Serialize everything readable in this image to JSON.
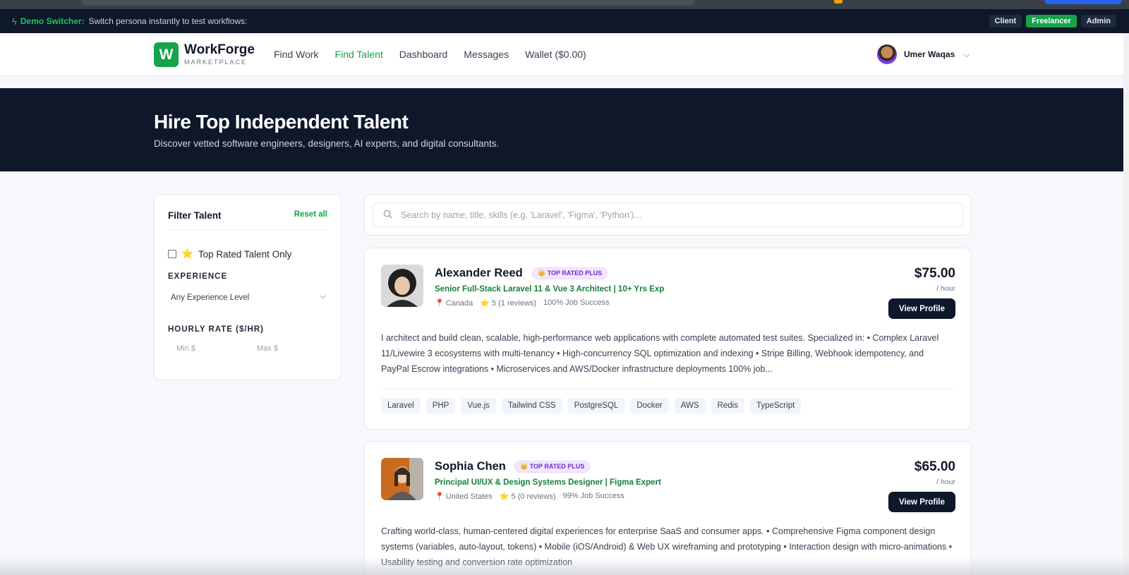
{
  "demo_bar": {
    "label": "Demo Switcher:",
    "text": "Switch persona instantly to test workflows:",
    "personas": [
      "Client",
      "Freelancer",
      "Admin"
    ]
  },
  "nav": {
    "brand": "WorkForge",
    "brand_sub": "MARKETPLACE",
    "logo_letter": "W",
    "links": [
      "Find Work",
      "Find Talent",
      "Dashboard",
      "Messages",
      "Wallet ($0.00)"
    ],
    "active_link": "Find Talent",
    "user_name": "Umer Waqas"
  },
  "hero": {
    "title": "Hire Top Independent Talent",
    "subtitle": "Discover vetted software engineers, designers, AI experts, and digital consultants."
  },
  "filters": {
    "title": "Filter Talent",
    "reset_label": "Reset all",
    "top_rated_label": "Top Rated Talent Only",
    "top_rated_checked": false,
    "experience_label": "EXPERIENCE",
    "experience_value": "Any Experience Level",
    "rate_label": "HOURLY RATE ($/HR)",
    "min_placeholder": "Min $",
    "max_placeholder": "Max $"
  },
  "search": {
    "placeholder": "Search by name, title, skills (e.g. 'Laravel', 'Figma', 'Python')..."
  },
  "talents": [
    {
      "name": "Alexander Reed",
      "badge": "TOP RATED PLUS",
      "title": "Senior Full-Stack Laravel 11 & Vue 3 Architect | 10+ Yrs Exp",
      "location": "Canada",
      "rating": "5 (1 reviews)",
      "job_success": "100% Job Success",
      "price": "$75.00",
      "per": "/ hour",
      "button": "View Profile",
      "bio": "I architect and build clean, scalable, high-performance web applications with complete automated test suites. Specialized in: • Complex Laravel 11/Livewire 3 ecosystems with multi-tenancy • High-concurrency SQL optimization and indexing • Stripe Billing, Webhook idempotency, and PayPal Escrow integrations • Microservices and AWS/Docker infrastructure deployments 100% job...",
      "skills": [
        "Laravel",
        "PHP",
        "Vue.js",
        "Tailwind CSS",
        "PostgreSQL",
        "Docker",
        "AWS",
        "Redis",
        "TypeScript"
      ]
    },
    {
      "name": "Sophia Chen",
      "badge": "TOP RATED PLUS",
      "title": "Principal UI/UX & Design Systems Designer | Figma Expert",
      "location": "United States",
      "rating": "5 (0 reviews)",
      "job_success": "99% Job Success",
      "price": "$65.00",
      "per": "/ hour",
      "button": "View Profile",
      "bio": "Crafting world-class, human-centered digital experiences for enterprise SaaS and consumer apps. • Comprehensive Figma component design systems (variables, auto-layout, tokens) • Mobile (iOS/Android) & Web UX wireframing and prototyping • Interaction design with micro-animations • Usability testing and conversion rate optimization",
      "skills": []
    }
  ],
  "colors": {
    "accent": "#16a34a",
    "dark": "#0f172a",
    "badge_text": "#6d28d9"
  }
}
